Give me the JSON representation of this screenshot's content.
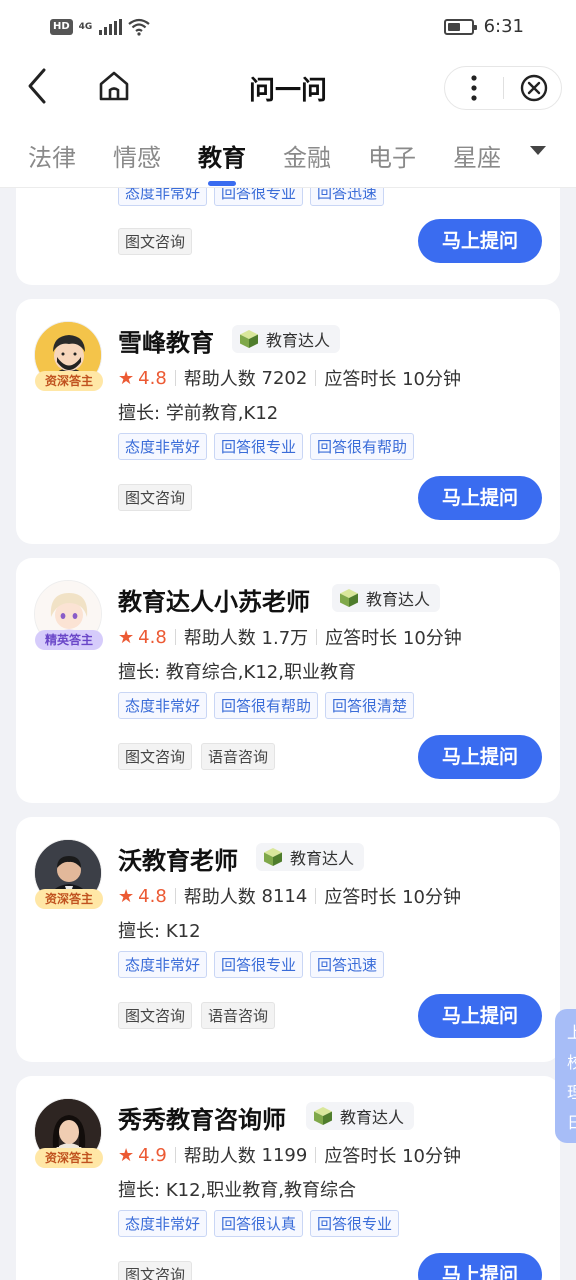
{
  "status_bar": {
    "hd": "HD",
    "network": "4G",
    "time": "6:31",
    "battery_level": 0.55
  },
  "nav": {
    "title": "问一问"
  },
  "tabs": [
    {
      "label": "法律",
      "active": false
    },
    {
      "label": "情感",
      "active": false
    },
    {
      "label": "教育",
      "active": true
    },
    {
      "label": "金融",
      "active": false
    },
    {
      "label": "电子",
      "active": false
    },
    {
      "label": "星座",
      "active": false
    }
  ],
  "labels": {
    "stars": "★",
    "help_count": "帮助人数",
    "response_time": "应答时长",
    "expertise_prefix": "擅长:",
    "ask_button": "马上提问"
  },
  "top_partial_card": {
    "tags": [
      "态度非常好",
      "回答很专业",
      "回答迅速"
    ],
    "services": [
      "图文咨询"
    ]
  },
  "experts": [
    {
      "name": "雪峰教育",
      "title": "教育达人",
      "badge": "资深答主",
      "badge_type": "senior",
      "rating": "4.8",
      "help_count": "7202",
      "response_time": "10分钟",
      "expertise": "学前教育,K12",
      "tags": [
        "态度非常好",
        "回答很专业",
        "回答很有帮助"
      ],
      "services": [
        "图文咨询"
      ]
    },
    {
      "name": "教育达人小苏老师",
      "title": "教育达人",
      "badge": "精英答主",
      "badge_type": "elite",
      "rating": "4.8",
      "help_count": "1.7万",
      "response_time": "10分钟",
      "expertise": "教育综合,K12,职业教育",
      "tags": [
        "态度非常好",
        "回答很有帮助",
        "回答很清楚"
      ],
      "services": [
        "图文咨询",
        "语音咨询"
      ]
    },
    {
      "name": "沃教育老师",
      "title": "教育达人",
      "badge": "资深答主",
      "badge_type": "senior",
      "rating": "4.8",
      "help_count": "8114",
      "response_time": "10分钟",
      "expertise": "K12",
      "tags": [
        "态度非常好",
        "回答很专业",
        "回答迅速"
      ],
      "services": [
        "图文咨询",
        "语音咨询"
      ]
    },
    {
      "name": "秀秀教育咨询师",
      "title": "教育达人",
      "badge": "资深答主",
      "badge_type": "senior",
      "rating": "4.9",
      "help_count": "1199",
      "response_time": "10分钟",
      "expertise": "K12,职业教育,教育综合",
      "tags": [
        "态度非常好",
        "回答很认真",
        "回答很专业"
      ],
      "services": [
        "图文咨询"
      ]
    }
  ],
  "float_tab": {
    "chars": [
      "上",
      "校",
      "理",
      "日"
    ]
  },
  "colors": {
    "primary": "#3a6cf0",
    "rating": "#ec5a34",
    "tag_text": "#3a6cd8",
    "senior_badge": "#ffe7a6",
    "elite_badge": "#d6ccfb"
  }
}
